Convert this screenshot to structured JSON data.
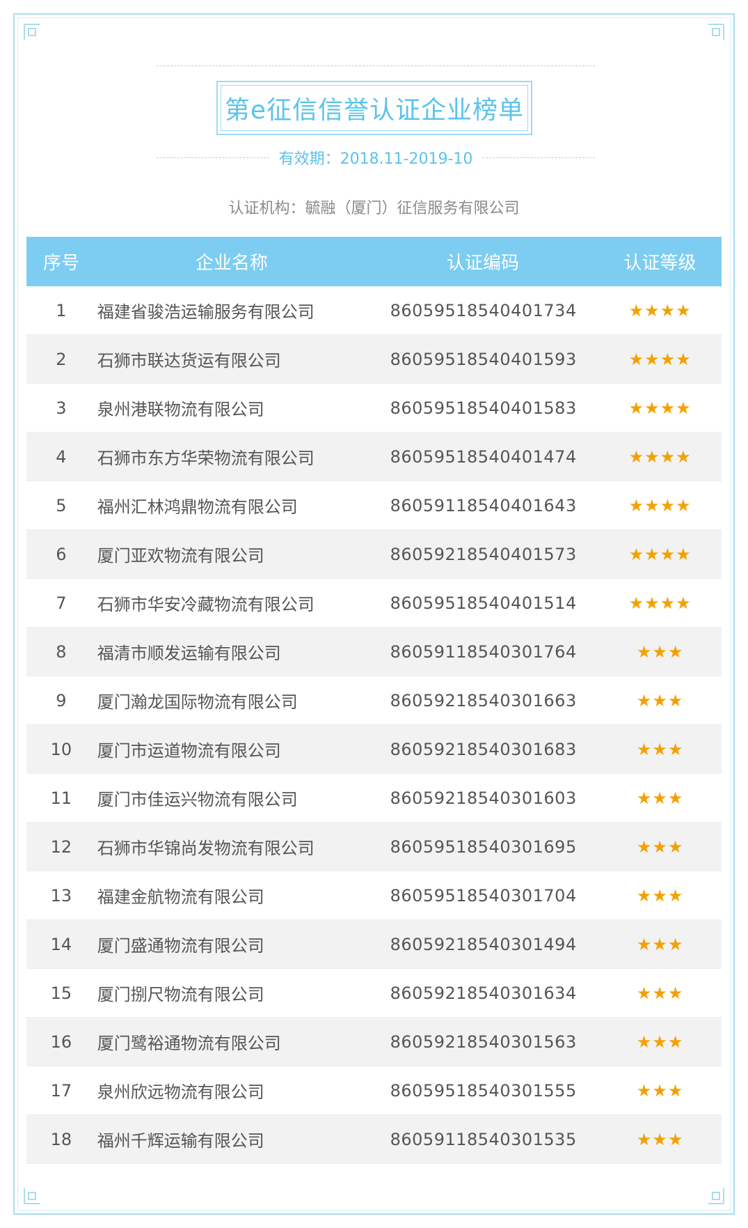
{
  "header": {
    "title": "第e征信信誉认证企业榜单",
    "validity": "有效期：2018.11-2019-10",
    "issuer": "认证机构：毓融（厦门）征信服务有限公司"
  },
  "columns": [
    "序号",
    "企业名称",
    "认证编码",
    "认证等级"
  ],
  "colors": {
    "accent": "#5bc3ea",
    "header_bg": "#7ccdf1",
    "star": "#f3a100"
  },
  "rows": [
    {
      "no": "1",
      "name": "福建省骏浩运输服务有限公司",
      "code": "86059518540401734",
      "stars": "★★★★"
    },
    {
      "no": "2",
      "name": "石狮市联达货运有限公司",
      "code": "86059518540401593",
      "stars": "★★★★"
    },
    {
      "no": "3",
      "name": "泉州港联物流有限公司",
      "code": "86059518540401583",
      "stars": "★★★★"
    },
    {
      "no": "4",
      "name": "石狮市东方华荣物流有限公司",
      "code": "86059518540401474",
      "stars": "★★★★"
    },
    {
      "no": "5",
      "name": "福州汇林鸿鼎物流有限公司",
      "code": "86059118540401643",
      "stars": "★★★★"
    },
    {
      "no": "6",
      "name": "厦门亚欢物流有限公司",
      "code": "86059218540401573",
      "stars": "★★★★"
    },
    {
      "no": "7",
      "name": "石狮市华安冷藏物流有限公司",
      "code": "86059518540401514",
      "stars": "★★★★"
    },
    {
      "no": "8",
      "name": "福清市顺发运输有限公司",
      "code": "86059118540301764",
      "stars": "★★★"
    },
    {
      "no": "9",
      "name": "厦门瀚龙国际物流有限公司",
      "code": "86059218540301663",
      "stars": "★★★"
    },
    {
      "no": "10",
      "name": "厦门市运道物流有限公司",
      "code": "86059218540301683",
      "stars": "★★★"
    },
    {
      "no": "11",
      "name": "厦门市佳运兴物流有限公司",
      "code": "86059218540301603",
      "stars": "★★★"
    },
    {
      "no": "12",
      "name": "石狮市华锦尚发物流有限公司",
      "code": "86059518540301695",
      "stars": "★★★"
    },
    {
      "no": "13",
      "name": "福建金航物流有限公司",
      "code": "86059518540301704",
      "stars": "★★★"
    },
    {
      "no": "14",
      "name": "厦门盛通物流有限公司",
      "code": "86059218540301494",
      "stars": "★★★"
    },
    {
      "no": "15",
      "name": "厦门捌尺物流有限公司",
      "code": "86059218540301634",
      "stars": "★★★"
    },
    {
      "no": "16",
      "name": "厦门鹭裕通物流有限公司",
      "code": "86059218540301563",
      "stars": "★★★"
    },
    {
      "no": "17",
      "name": "泉州欣远物流有限公司",
      "code": "86059518540301555",
      "stars": "★★★"
    },
    {
      "no": "18",
      "name": "福州千辉运输有限公司",
      "code": "86059118540301535",
      "stars": "★★★"
    }
  ]
}
